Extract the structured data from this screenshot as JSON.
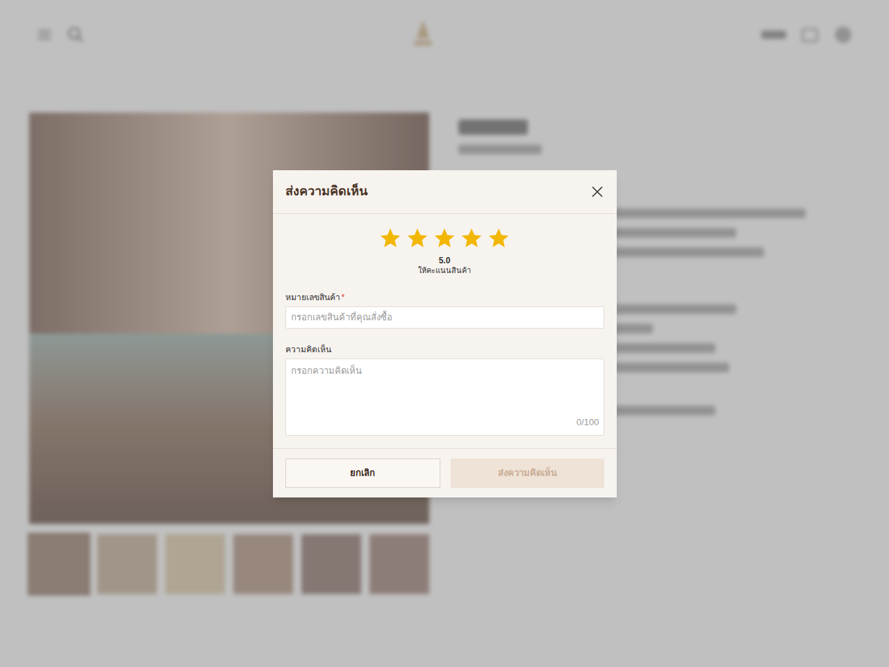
{
  "dialog": {
    "title": "ส่งความคิดเห็น"
  },
  "rating": {
    "stars": 5,
    "max": 5,
    "score": "5.0",
    "caption": "ให้คะแนนสินค้า"
  },
  "fields": [
    {
      "kind": "input",
      "label": "หมายเลขสินค้า",
      "required": true,
      "required_mark": "*",
      "placeholder": "กรอกเลขสินค้าที่คุณสั่งซื้อ",
      "value": ""
    },
    {
      "kind": "textarea",
      "label": "ความคิดเห็น",
      "required": false,
      "required_mark": "",
      "placeholder": "กรอกความคิดเห็น",
      "value": "",
      "counter": "0/100"
    }
  ],
  "buttons": [
    {
      "label": "ยกเลิก",
      "kind": "secondary",
      "disabled": false
    },
    {
      "label": "ส่งความคิดเห็น",
      "kind": "primary",
      "disabled": true
    }
  ],
  "gallery": {
    "thumbnails": [
      {
        "selected": true
      },
      {
        "selected": false
      },
      {
        "selected": false
      },
      {
        "selected": false
      },
      {
        "selected": false
      },
      {
        "selected": false
      }
    ]
  }
}
